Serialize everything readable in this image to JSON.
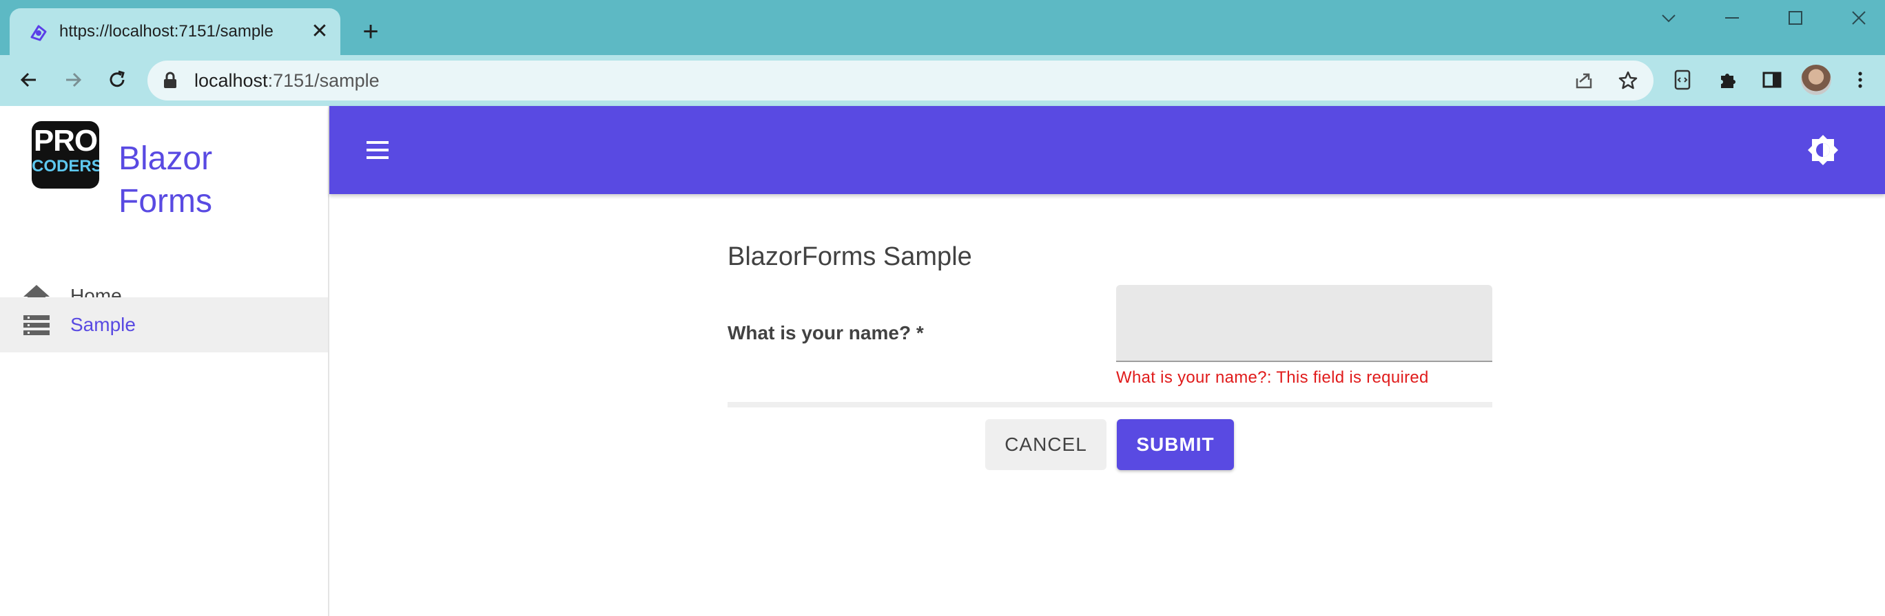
{
  "browser": {
    "tab": {
      "title": "https://localhost:7151/sample",
      "close_glyph": "✕",
      "favicon": "blazor-icon"
    },
    "new_tab_glyph": "+",
    "address": {
      "host": "localhost",
      "path": ":7151/sample"
    },
    "window_controls": [
      "chevron-down-icon",
      "minimize-icon",
      "maximize-icon",
      "close-icon"
    ],
    "toolbar_icons": [
      "back-icon",
      "forward-icon",
      "reload-icon",
      "lock-icon",
      "share-icon",
      "bookmark-star-icon",
      "extension-code-icon",
      "puzzle-icon",
      "side-panel-icon",
      "profile-avatar",
      "kebab-menu-icon"
    ]
  },
  "app": {
    "logo": {
      "line1": "PRO",
      "line2": "CODERS"
    },
    "brand": "Blazor Forms",
    "accent_color": "#594ae2",
    "nav": [
      {
        "label": "Home",
        "icon": "home-icon",
        "active": false
      },
      {
        "label": "Sample",
        "icon": "list-icon",
        "active": true
      }
    ],
    "appbar": {
      "menu_icon": "hamburger-menu-icon",
      "theme_icon": "brightness-toggle-icon"
    }
  },
  "form": {
    "title": "BlazorForms Sample",
    "fields": [
      {
        "label": "What is your name? *",
        "value": "",
        "error": "What is your name?: This field is required"
      }
    ],
    "buttons": {
      "cancel": "CANCEL",
      "submit": "SUBMIT"
    }
  }
}
